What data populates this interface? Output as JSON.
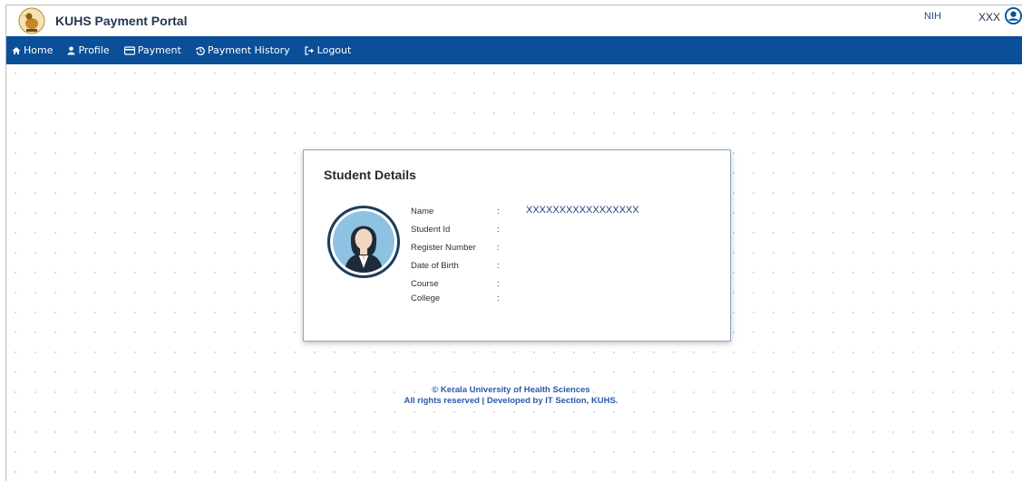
{
  "header": {
    "brand": "KUHS Payment Portal",
    "institute_code": "NIH",
    "user_name": "XXX",
    "logo_icon": "kuhs-emblem",
    "user_icon": "user-circle-icon"
  },
  "nav": {
    "items": [
      {
        "label": "Home",
        "icon": "home-icon"
      },
      {
        "label": "Profile",
        "icon": "user-icon"
      },
      {
        "label": "Payment",
        "icon": "credit-card-icon"
      },
      {
        "label": "Payment History",
        "icon": "history-icon"
      },
      {
        "label": "Logout",
        "icon": "logout-icon"
      }
    ]
  },
  "student": {
    "title": "Student Details",
    "fields": [
      {
        "label": "Name",
        "value": "XXXXXXXXXXXXXXXXX"
      },
      {
        "label": "Student Id",
        "value": ""
      },
      {
        "label": "Register Number",
        "value": ""
      },
      {
        "label": "Date of Birth",
        "value": ""
      },
      {
        "label": "Course",
        "value": ""
      },
      {
        "label": "College",
        "value": ""
      }
    ]
  },
  "footer": {
    "line1": "© Kerala University of Health Sciences",
    "line2": "All rights reserved | Developed by IT Section, KUHS."
  },
  "colors": {
    "nav_bg": "#0a4f98",
    "brand_text": "#24364f",
    "footer_text": "#2a5aa8"
  }
}
